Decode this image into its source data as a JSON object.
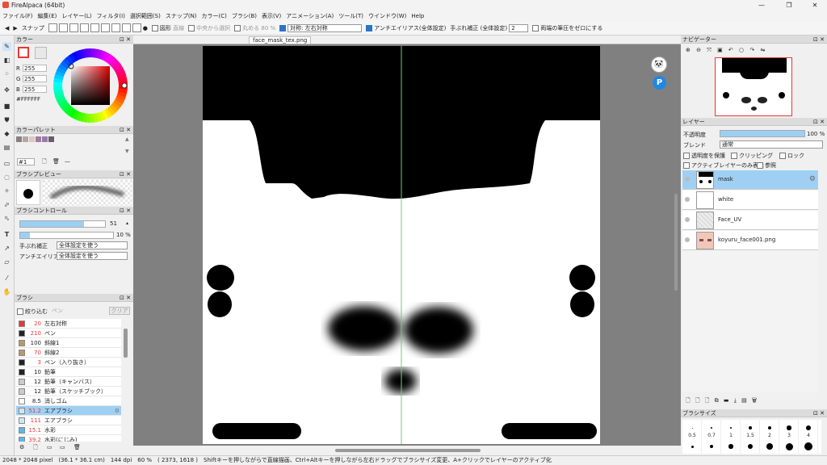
{
  "app": {
    "title": "FireAlpaca (64bit)",
    "window_buttons": [
      "—",
      "❐",
      "✕"
    ]
  },
  "menu": [
    "ファイル(F)",
    "編集(E)",
    "レイヤー(L)",
    "フィルタ(I)",
    "選択範囲(S)",
    "スナップ(N)",
    "カラー(C)",
    "ブラシ(B)",
    "表示(V)",
    "アニメーション(A)",
    "ツール(T)",
    "ウインドウ(W)",
    "Help"
  ],
  "toolbar": {
    "snap_label": "スナップ",
    "shape_label": "図形",
    "shape_value": "直線",
    "center_label": "中央から選択",
    "round_label": "丸める",
    "round_value": "80",
    "round_unit": "%",
    "symmetry_label": "対称: 左右対称",
    "antialias_label": "アンチエイリアス(全体設定)",
    "stabilizer_label": "手ぶれ補正 (全体設定)",
    "stabilizer_value": "2",
    "pressure_label": "両端の筆圧をゼロにする"
  },
  "color_panel": {
    "title": "カラー",
    "r_label": "R",
    "r": "255",
    "g_label": "G",
    "g": "255",
    "b_label": "B",
    "b": "255",
    "hex": "#FFFFFF",
    "palette_title": "カラーパレット",
    "palette_swatches": [
      "#8a8080",
      "#b5a7a0",
      "#d9c9c6",
      "#a07ca0",
      "#9a7aa8",
      "#6a5a6a"
    ],
    "palette_index": "#1"
  },
  "brush_preview": {
    "title": "ブラシプレビュー"
  },
  "brush_control": {
    "title": "ブラシコントロール",
    "size": "51",
    "size_fraction": 0.75,
    "opacity": "10 %",
    "opacity_fraction": 0.1,
    "stabilizer_label": "手ぶれ補正",
    "stabilizer_value": "全体設定を使う",
    "antialias_label": "アンチエイリアス",
    "antialias_value": "全体設定を使う"
  },
  "brush_list": {
    "title": "ブラシ",
    "filter_label": "絞り込む",
    "filter_placeholder": "ペン",
    "clear_label": "クリア",
    "items": [
      {
        "color": "#e53935",
        "size": "20",
        "name": "左右対称",
        "red": true
      },
      {
        "color": "#222222",
        "size": "210",
        "name": "ペン",
        "red": true
      },
      {
        "color": "#b89a6a",
        "size": "100",
        "name": "斜線1",
        "red": false
      },
      {
        "color": "#b89a6a",
        "size": "70",
        "name": "斜線2",
        "red": true
      },
      {
        "color": "#222222",
        "size": "3",
        "name": "ペン（入り抜き）",
        "red": true
      },
      {
        "color": "#222222",
        "size": "10",
        "name": "鉛筆",
        "red": false
      },
      {
        "color": "#cccccc",
        "size": "12",
        "name": "鉛筆（キャンバス）",
        "red": false
      },
      {
        "color": "#cccccc",
        "size": "12",
        "name": "鉛筆（スケッチブック）",
        "red": false
      },
      {
        "color": "#ffffff",
        "size": "8.5",
        "name": "消しゴム",
        "red": false
      },
      {
        "color": "#cfe6f7",
        "size": "51.2",
        "name": "エアブラシ",
        "red": true,
        "active": true
      },
      {
        "color": "#cfe6f7",
        "size": "111",
        "name": "エアブラシ",
        "red": true
      },
      {
        "color": "#59b8e8",
        "size": "15.1",
        "name": "水彩",
        "red": true
      },
      {
        "color": "#59b8e8",
        "size": "39.2",
        "name": "水彩(にじみ)",
        "red": true
      }
    ]
  },
  "canvas": {
    "tab": "face_mask_tex.png"
  },
  "navigator": {
    "title": "ナビゲーター"
  },
  "layers": {
    "title": "レイヤー",
    "opacity_label": "不透明度",
    "opacity_value": "100 %",
    "opacity_fraction": 1.0,
    "blend_label": "ブレンド",
    "blend_value": "通常",
    "protect_label": "透明度を保護",
    "clipping_label": "クリッピング",
    "lock_label": "ロック",
    "active_only_label": "アクティブレイヤーのみ表示",
    "reference_label": "参照",
    "items": [
      {
        "name": "mask",
        "active": true
      },
      {
        "name": "white",
        "active": false
      },
      {
        "name": "Face_UV",
        "active": false
      },
      {
        "name": "koyuru_face001.png",
        "active": false
      }
    ]
  },
  "brush_size": {
    "title": "ブラシサイズ",
    "sizes": [
      "0.5",
      "0.7",
      "1",
      "1.5",
      "2",
      "3",
      "4"
    ]
  },
  "status": {
    "text": "2048 * 2048 pixel　(36.1 * 36.1 cm)　144 dpi　60 %　( 2373, 1618 )　Shiftキーを押しながらで直線描画、Ctrl+Altキーを押しながら左右ドラッグでブラシサイズ変更、A+クリックでレイヤーのアクティブ化"
  }
}
